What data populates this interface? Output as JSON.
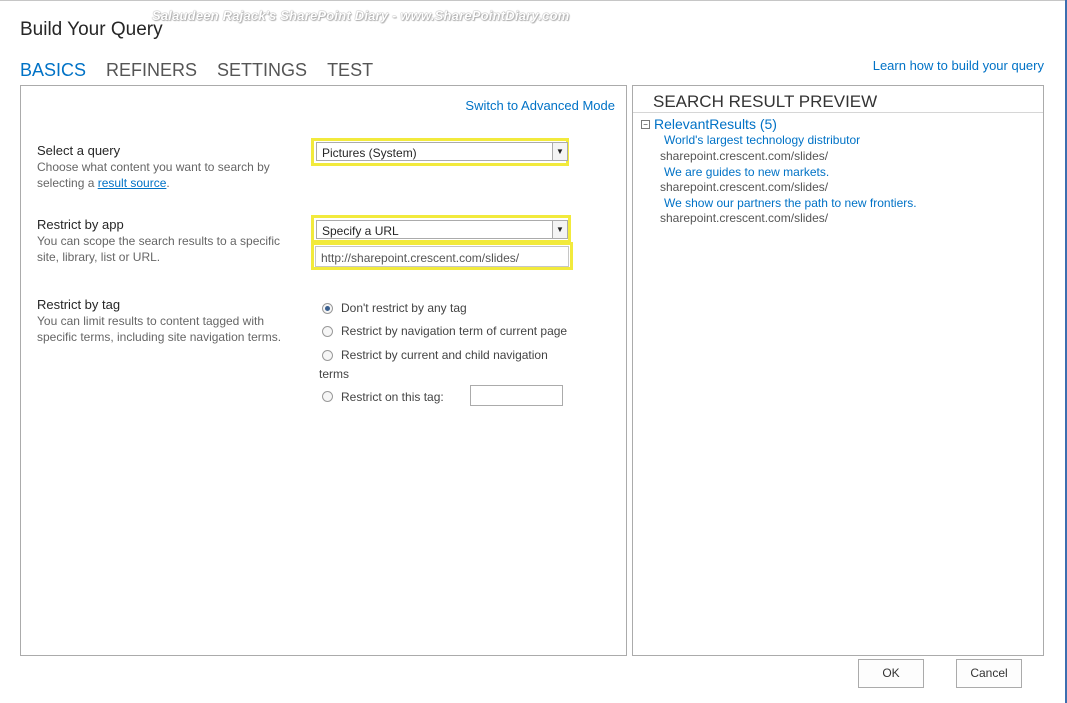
{
  "watermark": "Salaudeen Rajack's SharePoint Diary - www.SharePointDiary.com",
  "dialog_title": "Build Your Query",
  "tabs": [
    {
      "label": "BASICS",
      "active": true
    },
    {
      "label": "REFINERS",
      "active": false
    },
    {
      "label": "SETTINGS",
      "active": false
    },
    {
      "label": "TEST",
      "active": false
    }
  ],
  "learn_link": "Learn how to build your query",
  "advanced_link": "Switch to Advanced Mode",
  "select_query": {
    "title": "Select a query",
    "desc_pre": "Choose what content you want to search by selecting a ",
    "desc_link": "result source",
    "desc_post": ".",
    "value": "Pictures (System)"
  },
  "restrict_app": {
    "title": "Restrict by app",
    "desc": "You can scope the search results to a specific site, library, list or URL.",
    "value": "Specify a URL",
    "url_value": "http://sharepoint.crescent.com/slides/"
  },
  "restrict_tag": {
    "title": "Restrict by tag",
    "desc": "You can limit results to content tagged with specific terms, including site navigation terms.",
    "options": [
      "Don't restrict by any tag",
      "Restrict by navigation term of current page",
      "Restrict by current and child navigation",
      "terms",
      "Restrict on this tag:"
    ],
    "selected_index": 0
  },
  "preview": {
    "title": "SEARCH RESULT PREVIEW",
    "collapse_glyph": "−",
    "group": "RelevantResults (5)",
    "results": [
      {
        "title": "World's largest technology distributor",
        "url": "sharepoint.crescent.com/slides/"
      },
      {
        "title": "We are guides to new markets.",
        "url": "sharepoint.crescent.com/slides/"
      },
      {
        "title": "We show our partners the path to new frontiers.",
        "url": "sharepoint.crescent.com/slides/"
      }
    ]
  },
  "buttons": {
    "ok": "OK",
    "cancel": "Cancel"
  },
  "icons": {
    "dropdown": "chevron-down-icon",
    "collapse": "collapse-minus-icon"
  },
  "colors": {
    "accent": "#0072c6",
    "highlight": "#f2ea3c"
  }
}
